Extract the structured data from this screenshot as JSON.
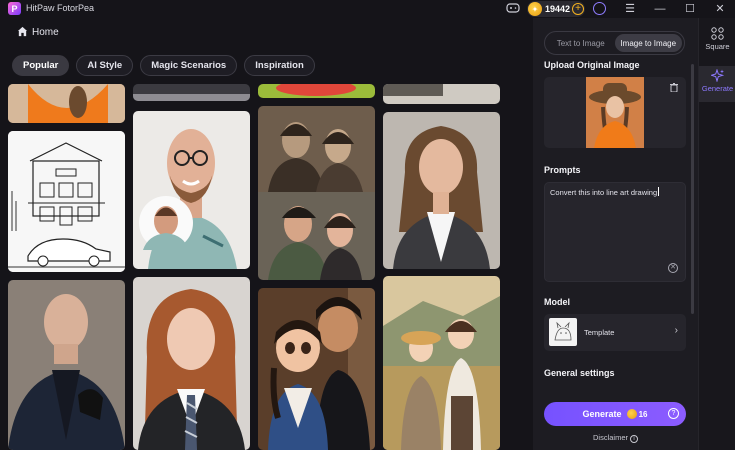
{
  "app": {
    "title": "HitPaw FotorPea",
    "logo_letter": "P",
    "credits": "19442"
  },
  "window_controls": {
    "menu": "☰",
    "minimize": "—",
    "maximize": "☐",
    "close": "✕"
  },
  "nav": {
    "home_label": "Home"
  },
  "categories": [
    {
      "label": "Popular",
      "active": true
    },
    {
      "label": "AI Style",
      "active": false
    },
    {
      "label": "Magic Scenarios",
      "active": false
    },
    {
      "label": "Inspiration",
      "active": false
    }
  ],
  "gallery_items": [
    {
      "name": "orange-sweater-portrait"
    },
    {
      "name": "dark-scene-thumbnail"
    },
    {
      "name": "food-thumbnail"
    },
    {
      "name": "black-white-photo-thumbnail"
    },
    {
      "name": "line-art-house-car"
    },
    {
      "name": "bald-man-caricature"
    },
    {
      "name": "vintage-couple-restoration"
    },
    {
      "name": "woman-blazer-portrait"
    },
    {
      "name": "bald-man-coat-portrait"
    },
    {
      "name": "young-woman-uniform"
    },
    {
      "name": "cartoon-couple"
    },
    {
      "name": "anime-couple-field"
    }
  ],
  "panel": {
    "modes": [
      {
        "label": "Text to Image",
        "active": false
      },
      {
        "label": "Image to Image",
        "active": true
      }
    ],
    "upload_title": "Upload Original Image",
    "prompts_title": "Prompts",
    "prompt_value": "Convert this into line art drawing",
    "model_title": "Model",
    "model_name": "Template",
    "general_settings_title": "General settings",
    "generate_label": "Generate",
    "generate_cost": "16",
    "disclaimer": "Disclaimer",
    "accent_color": "#7652ff"
  },
  "rail": {
    "items": [
      {
        "label": "Square",
        "active": false
      },
      {
        "label": "Generate",
        "active": true
      }
    ]
  }
}
